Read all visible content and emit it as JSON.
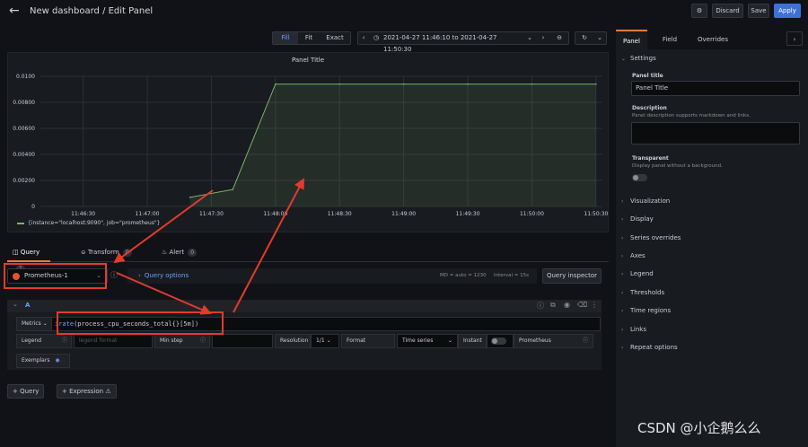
{
  "header": {
    "title": "New dashboard / Edit Panel",
    "discard_label": "Discard",
    "save_label": "Save",
    "apply_label": "Apply"
  },
  "time_controls": {
    "fill": "Fill",
    "fit": "Fit",
    "exact": "Exact",
    "range": "2021-04-27 11:46:10 to 2021-04-27 11:50:30"
  },
  "chart_data": {
    "type": "area",
    "title": "Panel Title",
    "xlabel": "",
    "ylabel": "",
    "x": [
      "11:47:20",
      "11:47:40",
      "11:48:00",
      "11:48:30",
      "11:49:00",
      "11:49:30",
      "11:50:00",
      "11:50:30"
    ],
    "series": [
      {
        "name": "{instance=\"localhost:9090\", job=\"prometheus\"}",
        "color": "#7eb26d",
        "values": [
          0.0007,
          0.0013,
          0.0094,
          0.0094,
          0.0094,
          0.0094,
          0.0094,
          0.0094
        ]
      }
    ],
    "x_ticks": [
      "11:46:30",
      "11:47:00",
      "11:47:30",
      "11:48:00",
      "11:48:30",
      "11:49:00",
      "11:49:30",
      "11:50:00",
      "11:50:30"
    ],
    "y_ticks": [
      "0",
      "0.00200",
      "0.00400",
      "0.00600",
      "0.00800",
      "0.0100"
    ],
    "ylim": [
      0,
      0.01
    ],
    "grid": true,
    "legend": "bottom-left"
  },
  "query_tabs": [
    {
      "label": "Query",
      "count": "1"
    },
    {
      "label": "Transform",
      "count": "0"
    },
    {
      "label": "Alert",
      "count": "0"
    }
  ],
  "datasource": {
    "name": "Prometheus-1"
  },
  "query_options": {
    "label": "Query options",
    "md": "MD = auto = 1230",
    "interval": "Interval = 15s",
    "inspector_label": "Query inspector"
  },
  "query": {
    "ref": "A",
    "metrics_label": "Metrics",
    "expr_fn": "irate",
    "expr_rest": "(process_cpu_seconds_total{}[5m])",
    "legend_label": "Legend",
    "legend_placeholder": "legend format",
    "min_step_label": "Min step",
    "resolution_label": "Resolution",
    "resolution_value": "1/1",
    "format_label": "Format",
    "format_value": "Time series",
    "instant_label": "Instant",
    "source_label": "Prometheus",
    "exemplars_label": "Exemplars"
  },
  "add_buttons": {
    "query": "Query",
    "expression": "Expression"
  },
  "sidebar": {
    "tabs": [
      "Panel",
      "Field",
      "Overrides"
    ],
    "settings_label": "Settings",
    "panel_title_label": "Panel title",
    "panel_title_value": "Panel Title",
    "description_label": "Description",
    "description_help": "Panel description supports markdown and links.",
    "transparent_label": "Transparent",
    "transparent_help": "Display panel without a background.",
    "sections": [
      "Visualization",
      "Display",
      "Series overrides",
      "Axes",
      "Legend",
      "Thresholds",
      "Time regions",
      "Links",
      "Repeat options"
    ]
  },
  "watermark": "CSDN @小企鹅么么"
}
